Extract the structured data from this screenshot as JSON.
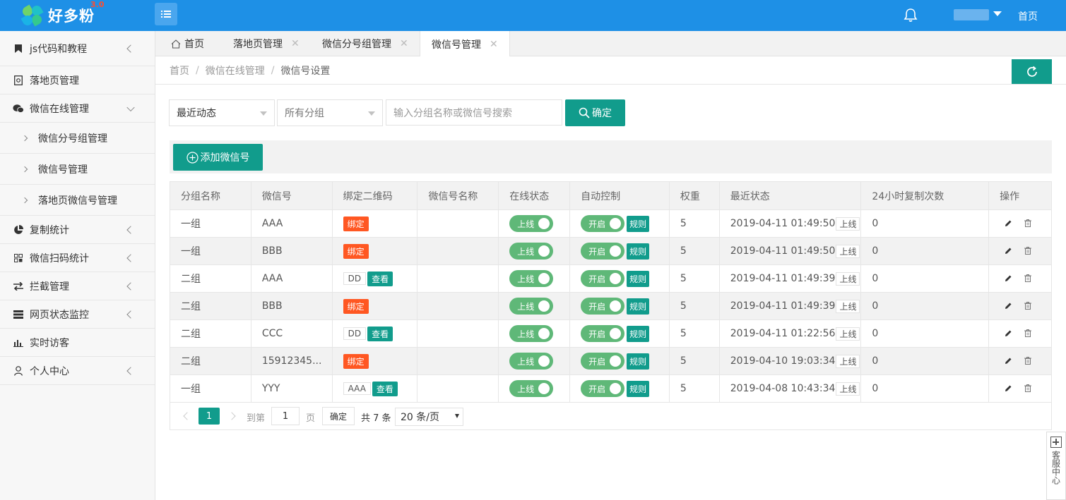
{
  "app": {
    "brand": "好多粉",
    "version": "3.0",
    "top_home": "首页"
  },
  "sidebar": {
    "items": [
      {
        "label": "js代码和教程",
        "icon": "bookmark-icon",
        "arrow": "left"
      },
      {
        "label": "落地页管理",
        "icon": "document-icon",
        "arrow": ""
      },
      {
        "label": "微信在线管理",
        "icon": "wechat-icon",
        "arrow": "down"
      },
      {
        "label": "微信分号组管理",
        "sub": true
      },
      {
        "label": "微信号管理",
        "sub": true
      },
      {
        "label": "落地页微信号管理",
        "sub": true
      },
      {
        "label": "复制统计",
        "icon": "pie-chart-icon",
        "arrow": "left"
      },
      {
        "label": "微信扫码统计",
        "icon": "qrcode-icon",
        "arrow": "left"
      },
      {
        "label": "拦截管理",
        "icon": "exchange-icon",
        "arrow": "left"
      },
      {
        "label": "网页状态监控",
        "icon": "server-icon",
        "arrow": "left"
      },
      {
        "label": "实时访客",
        "icon": "bar-chart-icon",
        "arrow": ""
      },
      {
        "label": "个人中心",
        "icon": "user-icon",
        "arrow": "left"
      }
    ]
  },
  "tabs": [
    {
      "label": "首页",
      "icon": "home-icon"
    },
    {
      "label": "落地页管理"
    },
    {
      "label": "微信分号组管理"
    },
    {
      "label": "微信号管理",
      "active": true
    }
  ],
  "breadcrumb": [
    "首页",
    "微信在线管理",
    "微信号设置"
  ],
  "filters": {
    "sort": "最近动态",
    "group": "所有分组",
    "search_placeholder": "输入分组名称或微信号搜索",
    "confirm": "确定"
  },
  "add_button": "添加微信号",
  "table": {
    "headers": [
      "分组名称",
      "微信号",
      "绑定二维码",
      "微信号名称",
      "在线状态",
      "自动控制",
      "权重",
      "最近状态",
      "24小时复制次数",
      "操作"
    ],
    "rows": [
      {
        "group": "一组",
        "wechat": "AAA",
        "qr_tag": "",
        "qr_bind": "绑定",
        "name": "",
        "online": "上线",
        "auto": "开启",
        "rule": "规则",
        "weight": "5",
        "time": "2019-04-11 01:49:50",
        "status": "上线",
        "copies": "0"
      },
      {
        "group": "一组",
        "wechat": "BBB",
        "qr_tag": "",
        "qr_bind": "绑定",
        "name": "",
        "online": "上线",
        "auto": "开启",
        "rule": "规则",
        "weight": "5",
        "time": "2019-04-11 01:49:50",
        "status": "上线",
        "copies": "0"
      },
      {
        "group": "二组",
        "wechat": "AAA",
        "qr_tag": "DD",
        "qr_view": "查看",
        "name": "",
        "online": "上线",
        "auto": "开启",
        "rule": "规则",
        "weight": "5",
        "time": "2019-04-11 01:49:39",
        "status": "上线",
        "copies": "0"
      },
      {
        "group": "二组",
        "wechat": "BBB",
        "qr_tag": "",
        "qr_bind": "绑定",
        "name": "",
        "online": "上线",
        "auto": "开启",
        "rule": "规则",
        "weight": "5",
        "time": "2019-04-11 01:49:39",
        "status": "上线",
        "copies": "0"
      },
      {
        "group": "二组",
        "wechat": "CCC",
        "qr_tag": "DD",
        "qr_view": "查看",
        "name": "",
        "online": "上线",
        "auto": "开启",
        "rule": "规则",
        "weight": "5",
        "time": "2019-04-11 01:22:56",
        "status": "上线",
        "copies": "0"
      },
      {
        "group": "二组",
        "wechat": "15912345...",
        "qr_tag": "",
        "qr_bind": "绑定",
        "name": "",
        "online": "上线",
        "auto": "开启",
        "rule": "规则",
        "weight": "5",
        "time": "2019-04-10 19:03:34",
        "status": "上线",
        "copies": "0"
      },
      {
        "group": "一组",
        "wechat": "YYY",
        "qr_tag": "AAA",
        "qr_view": "查看",
        "name": "",
        "online": "上线",
        "auto": "开启",
        "rule": "规则",
        "weight": "5",
        "time": "2019-04-08 10:43:34",
        "status": "上线",
        "copies": "0"
      }
    ]
  },
  "pager": {
    "current": "1",
    "goto_label": "到第",
    "goto_value": "1",
    "page_label": "页",
    "confirm": "确定",
    "total": "共 7 条",
    "page_size": "20 条/页"
  },
  "customer_service": "客服中心",
  "colors": {
    "topbar": "#1e90e6",
    "primary": "#119c8c",
    "bind": "#ff5722",
    "switch": "#5fb878"
  }
}
